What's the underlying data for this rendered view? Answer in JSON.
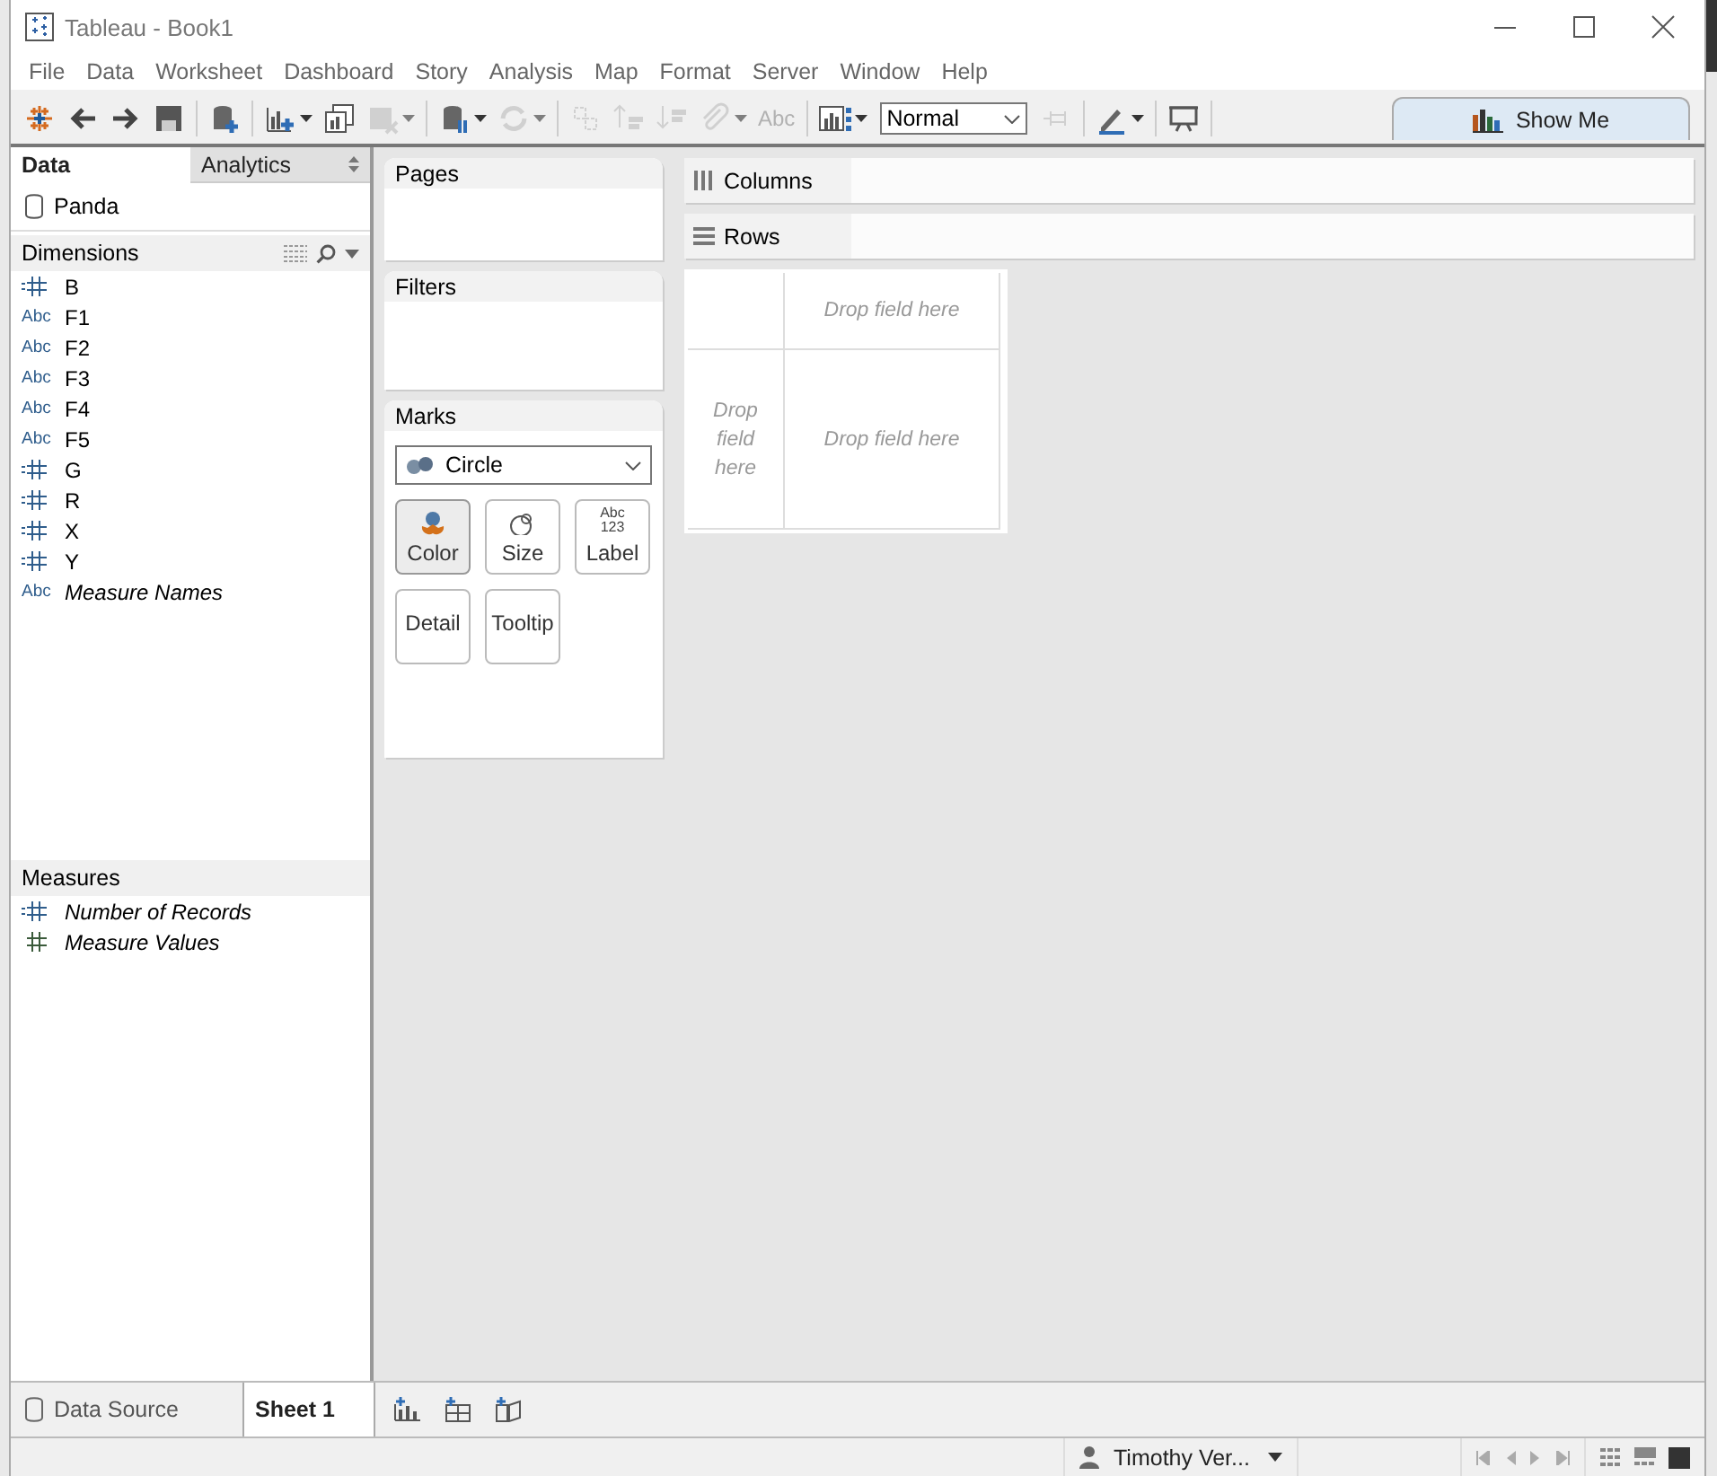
{
  "window": {
    "title": "Tableau - Book1"
  },
  "menu": [
    "File",
    "Data",
    "Worksheet",
    "Dashboard",
    "Story",
    "Analysis",
    "Map",
    "Format",
    "Server",
    "Window",
    "Help"
  ],
  "toolbar": {
    "buttons": [
      {
        "disabled": false,
        "dropdown": false
      },
      {
        "disabled": false,
        "dropdown": false
      },
      {
        "disabled": false,
        "dropdown": false
      },
      {
        "disabled": false,
        "dropdown": false
      },
      {
        "disabled": false,
        "dropdown": false
      },
      {
        "disabled": false,
        "dropdown": true
      },
      {
        "disabled": false,
        "dropdown": false
      },
      {
        "disabled": true,
        "dropdown": true
      },
      {
        "disabled": false,
        "dropdown": true
      },
      {
        "disabled": true,
        "dropdown": true
      },
      {
        "disabled": true,
        "dropdown": false
      },
      {
        "disabled": true,
        "dropdown": false
      },
      {
        "disabled": true,
        "dropdown": false
      },
      {
        "disabled": true,
        "dropdown": true
      },
      {
        "disabled": true,
        "dropdown": false,
        "label": "Abc"
      },
      {
        "disabled": false,
        "dropdown": true
      }
    ],
    "view_size": "Normal",
    "after": [
      {
        "disabled": true,
        "dropdown": false
      },
      {
        "disabled": false,
        "dropdown": true
      },
      {
        "disabled": false,
        "dropdown": false
      }
    ],
    "show_me": "Show Me"
  },
  "data_pane": {
    "tabs": [
      {
        "label": "Data",
        "selected": true
      },
      {
        "label": "Analytics",
        "selected": false
      }
    ],
    "data_source": "Panda",
    "dimensions": {
      "title": "Dimensions",
      "fields": [
        {
          "name": "B",
          "kind": "number",
          "italic": false
        },
        {
          "name": "F1",
          "kind": "string",
          "type_label": "Abc",
          "italic": false
        },
        {
          "name": "F2",
          "kind": "string",
          "type_label": "Abc",
          "italic": false
        },
        {
          "name": "F3",
          "kind": "string",
          "type_label": "Abc",
          "italic": false
        },
        {
          "name": "F4",
          "kind": "string",
          "type_label": "Abc",
          "italic": false
        },
        {
          "name": "F5",
          "kind": "string",
          "type_label": "Abc",
          "italic": false
        },
        {
          "name": "G",
          "kind": "number",
          "italic": false
        },
        {
          "name": "R",
          "kind": "number",
          "italic": false
        },
        {
          "name": "X",
          "kind": "number",
          "italic": false
        },
        {
          "name": "Y",
          "kind": "number",
          "italic": false
        },
        {
          "name": "Measure Names",
          "kind": "string",
          "type_label": "Abc",
          "italic": true
        }
      ]
    },
    "measures": {
      "title": "Measures",
      "fields": [
        {
          "name": "Number of Records",
          "kind": "number",
          "italic": true
        },
        {
          "name": "Measure Values",
          "kind": "measure",
          "italic": true
        }
      ]
    }
  },
  "shelves": {
    "pages": "Pages",
    "filters": "Filters",
    "marks": {
      "title": "Marks",
      "mark_type": "Circle",
      "cards": [
        {
          "label": "Color",
          "selected": true
        },
        {
          "label": "Size",
          "selected": false
        },
        {
          "label": "Label",
          "glyph": "Abc 123",
          "selected": false
        },
        {
          "label": "Detail",
          "selected": false
        },
        {
          "label": "Tooltip",
          "selected": false
        }
      ]
    },
    "columns": "Columns",
    "rows": "Rows"
  },
  "view": {
    "drop_top": "Drop field here",
    "drop_left": "Drop field here",
    "drop_main": "Drop field here"
  },
  "sheet_tabs": [
    {
      "label": "Data Source",
      "kind": "source",
      "selected": false
    },
    {
      "label": "Sheet 1",
      "kind": "sheet",
      "selected": true
    }
  ],
  "status_bar": {
    "user": "Timothy Ver..."
  }
}
